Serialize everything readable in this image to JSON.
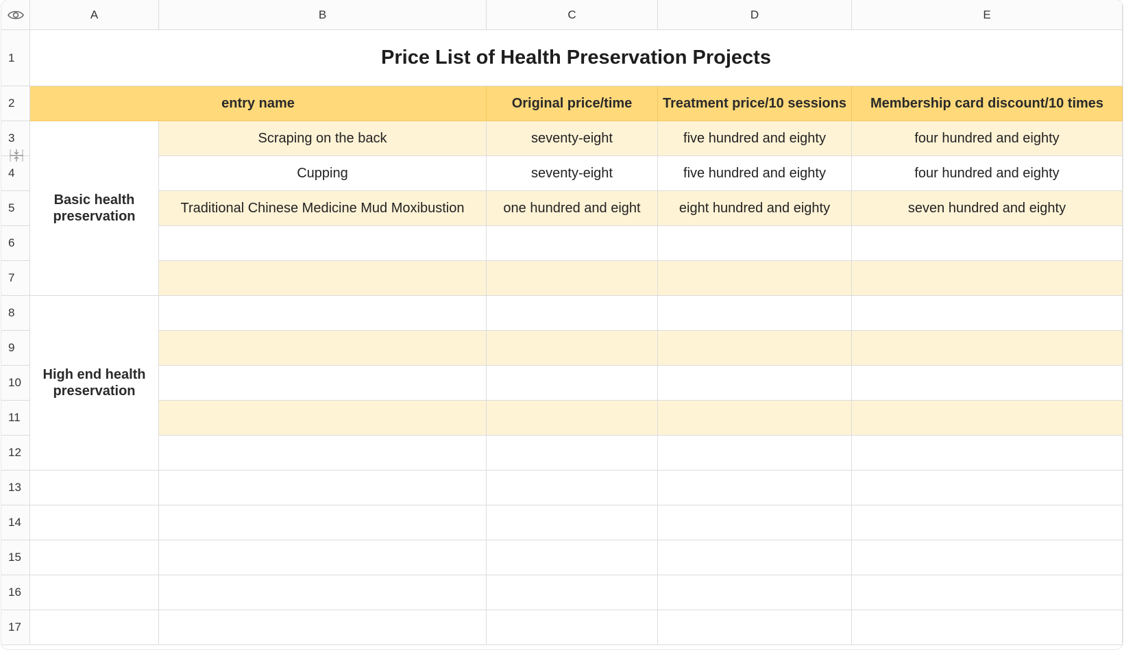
{
  "columns": [
    "A",
    "B",
    "C",
    "D",
    "E"
  ],
  "rows": [
    "1",
    "2",
    "3",
    "4",
    "5",
    "6",
    "7",
    "8",
    "9",
    "10",
    "11",
    "12",
    "13",
    "14",
    "15",
    "16",
    "17"
  ],
  "title": "Price List of Health Preservation Projects",
  "header": {
    "entry_name": "entry name",
    "original_price": "Original price/time",
    "treatment_price": "Treatment price/10 sessions",
    "membership_discount": "Membership card discount/10 times"
  },
  "groups": {
    "basic": "Basic health preservation",
    "high_end": "High end health preservation"
  },
  "data": [
    {
      "name": "Scraping on the back",
      "original": "seventy-eight",
      "treatment": "five hundred and eighty",
      "member": "four hundred and eighty"
    },
    {
      "name": "Cupping",
      "original": "seventy-eight",
      "treatment": "five hundred and eighty",
      "member": "four hundred and eighty"
    },
    {
      "name": "Traditional Chinese Medicine Mud Moxibustion",
      "original": "one hundred and eight",
      "treatment": "eight hundred and eighty",
      "member": "seven hundred and eighty"
    }
  ],
  "colors": {
    "header_fill": "#ffd97a",
    "band_fill": "#fff3d6",
    "grid_line": "#dcdcdc"
  },
  "icons": {
    "corner": "eye-icon",
    "row_resize": "row-resize-icon"
  }
}
